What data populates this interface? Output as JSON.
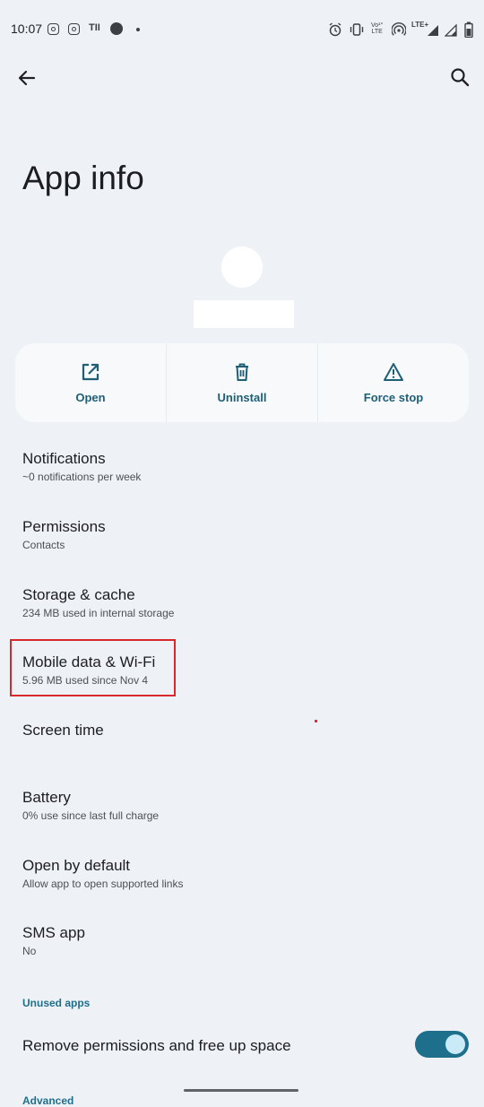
{
  "status_bar": {
    "time": "10:07",
    "signal_text": "LTE+",
    "volte_line1": "Vo¹°",
    "volte_line2": "LTE"
  },
  "top_bar": {
    "back_icon": "arrow-left-icon",
    "search_icon": "search-icon"
  },
  "page": {
    "title": "App info"
  },
  "actions": [
    {
      "label": "Open",
      "icon": "open-external-icon"
    },
    {
      "label": "Uninstall",
      "icon": "trash-icon"
    },
    {
      "label": "Force stop",
      "icon": "warning-triangle-icon"
    }
  ],
  "items": [
    {
      "title": "Notifications",
      "subtitle": "~0 notifications per week"
    },
    {
      "title": "Permissions",
      "subtitle": "Contacts"
    },
    {
      "title": "Storage & cache",
      "subtitle": "234 MB used in internal storage"
    },
    {
      "title": "Mobile data & Wi-Fi",
      "subtitle": "5.96 MB used since Nov 4"
    },
    {
      "title": "Screen time",
      "subtitle": ""
    },
    {
      "title": "Battery",
      "subtitle": "0% use since last full charge"
    },
    {
      "title": "Open by default",
      "subtitle": "Allow app to open supported links"
    },
    {
      "title": "SMS app",
      "subtitle": "No"
    }
  ],
  "unused_apps": {
    "header": "Unused apps",
    "toggle_label": "Remove permissions and free up space",
    "toggle_on": true
  },
  "advanced": {
    "header": "Advanced"
  },
  "colors": {
    "accent": "#1e6f8c",
    "background": "#eef2f6",
    "highlight": "#d8282c"
  }
}
